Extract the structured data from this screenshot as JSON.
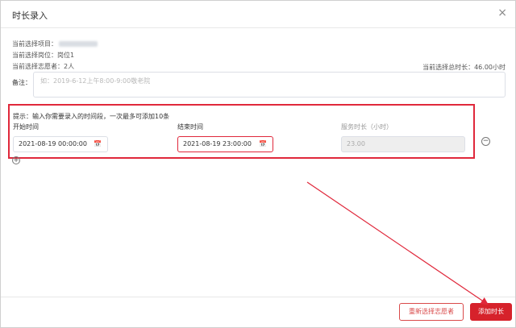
{
  "dialog": {
    "title": "时长录入",
    "close_icon": "×"
  },
  "info": {
    "project_label": "当前选择项目：",
    "post_label": "当前选择岗位：",
    "post_value": "岗位1",
    "volunteers_label": "当前选择志愿者：",
    "volunteers_value": "2人",
    "total_label": "当前选择总时长：",
    "total_value": "46.00小时"
  },
  "remark": {
    "label": "备注：",
    "placeholder": "如：2019-6-12上午8:00-9:00敬老院"
  },
  "entry": {
    "hint": "提示：输入你需要录入的时间段，一次最多可添加10条",
    "start_label": "开始时间",
    "end_label": "结束时间",
    "duration_label": "服务时长（小时）",
    "start_value": "2021-08-19 00:00:00",
    "end_value": "2021-08-19 23:00:00",
    "duration_value": "23.00",
    "calendar_icon": "📅",
    "remove_icon": "−",
    "add_icon": "+"
  },
  "footer": {
    "reselect_label": "重新选择志愿者",
    "add_label": "添加时长"
  },
  "colors": {
    "accent": "#d6222b",
    "highlight": "#e0283b"
  }
}
